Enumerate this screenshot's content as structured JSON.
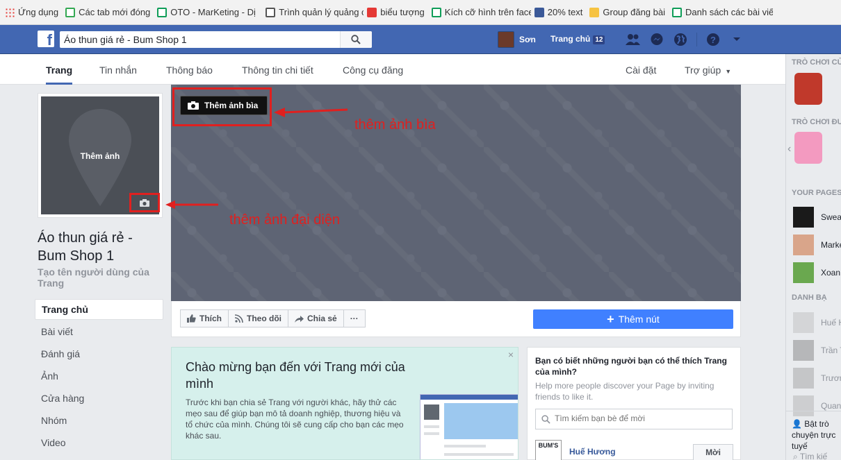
{
  "bookmarks": [
    {
      "label": "Ứng dụng",
      "icon": "apps-grid-icon"
    },
    {
      "label": "Các tab mới đóng",
      "icon": "history-icon"
    },
    {
      "label": "OTO - MarKeting - Dị",
      "icon": "sheet-icon"
    },
    {
      "label": "Trình quản lý quảng c",
      "icon": "printer-icon"
    },
    {
      "label": "biểu tượng",
      "icon": "flash-icon"
    },
    {
      "label": "Kích cỡ hình trên face",
      "icon": "sheet-icon"
    },
    {
      "label": "20% text",
      "icon": "facebook-icon"
    },
    {
      "label": "Group đăng bài",
      "icon": "folder-icon"
    },
    {
      "label": "Danh sách các bài viết",
      "icon": "sheet-icon"
    }
  ],
  "topbar": {
    "search_value": "Áo thun giá rẻ - Bum Shop 1",
    "user_name": "Sơn",
    "home_label": "Trang chủ",
    "home_badge": "12"
  },
  "pagenav": {
    "tabs": [
      "Trang",
      "Tin nhắn",
      "Thông báo",
      "Thông tin chi tiết",
      "Công cụ đăng"
    ],
    "settings": "Cài đặt",
    "help": "Trợ giúp"
  },
  "profile": {
    "add_photo": "Thêm ảnh",
    "page_name": "Áo thun giá rẻ - Bum Shop 1",
    "username_prompt": "Tạo tên người dùng của Trang"
  },
  "left_menu": [
    "Trang chủ",
    "Bài viết",
    "Đánh giá",
    "Ảnh",
    "Cửa hàng",
    "Nhóm",
    "Video"
  ],
  "cover": {
    "add_cover_label": "Thêm ảnh bìa"
  },
  "annotations": {
    "cover": "thêm ảnh bìa",
    "avatar": "thêm ảnh đại diện"
  },
  "actions": {
    "like": "Thích",
    "follow": "Theo dõi",
    "share": "Chia sẻ",
    "more": "···",
    "add_button": "Thêm nút"
  },
  "welcome": {
    "title": "Chào mừng bạn đến với Trang mới của mình",
    "body": "Trước khi bạn chia sẻ Trang với người khác, hãy thử các mẹo sau để giúp bạn mô tả doanh nghiệp, thương hiệu và tổ chức của mình. Chúng tôi sẽ cung cấp cho bạn các mẹo khác sau.",
    "close": "×"
  },
  "suggest": {
    "title": "Bạn có biết những người bạn có thể thích Trang của mình?",
    "subtitle": "Help more people discover your Page by inviting friends to like it.",
    "search_placeholder": "Tìm kiếm bạn bè để mời",
    "friend_name": "Huế Hương",
    "friend_avatar_text": "BUM'S",
    "invite": "Mời"
  },
  "right_sidebar": {
    "games_head_1": "TRÒ CHƠI CỦ",
    "games_head_2": "TRÒ CHƠI ĐƯ",
    "pages_head": "YOUR PAGES",
    "pages": [
      "Swea",
      "Marke",
      "Xoan"
    ],
    "contacts_head": "DANH BẠ",
    "contacts": [
      "Huế H",
      "Trần T",
      "Trươn",
      "Quan"
    ],
    "chat_label": "Bật trò chuyện trực tuyế",
    "search": "Tìm kiế"
  },
  "colors": {
    "fb_blue": "#4267b2",
    "button_blue": "#4080ff",
    "annotation_red": "#e0201f",
    "cover_gray": "#5e6474"
  }
}
